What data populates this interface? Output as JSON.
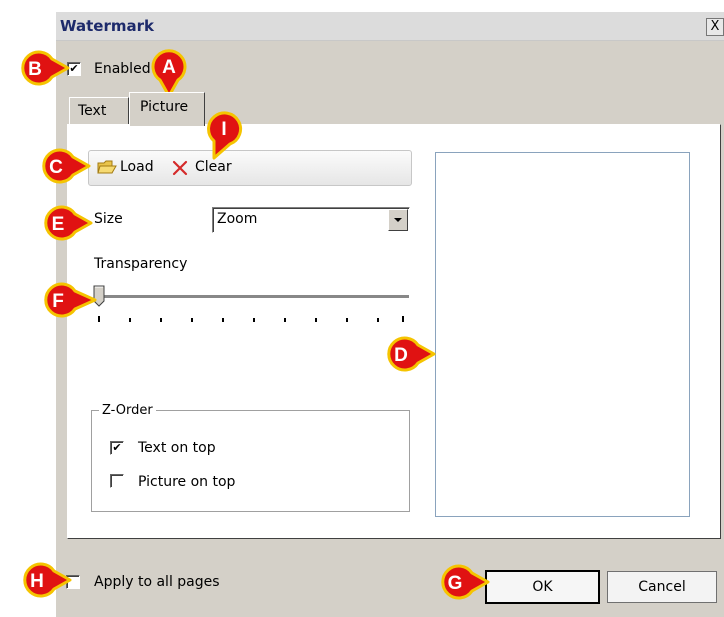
{
  "window": {
    "title": "Watermark",
    "close_glyph": "X"
  },
  "enabled": {
    "label": "Enabled",
    "checked": true
  },
  "tabs": [
    {
      "label": "Text",
      "active": false
    },
    {
      "label": "Picture",
      "active": true
    }
  ],
  "toolbar": {
    "load_label": "Load",
    "clear_label": "Clear"
  },
  "size": {
    "label": "Size",
    "value": "Zoom"
  },
  "transparency": {
    "label": "Transparency",
    "value": 0
  },
  "zorder": {
    "legend": "Z-Order",
    "options": [
      {
        "label": "Text on top",
        "checked": true
      },
      {
        "label": "Picture on top",
        "checked": false
      }
    ]
  },
  "apply_all": {
    "label": "Apply to all pages",
    "checked": false
  },
  "buttons": {
    "ok": "OK",
    "cancel": "Cancel"
  },
  "callouts": {
    "a": "A",
    "b": "B",
    "c": "C",
    "d": "D",
    "e": "E",
    "f": "F",
    "g": "G",
    "h": "H",
    "i": "I"
  },
  "colors": {
    "callout_fill": "#e01212",
    "callout_border": "#f5c400",
    "clear_x": "#d42a2a"
  }
}
